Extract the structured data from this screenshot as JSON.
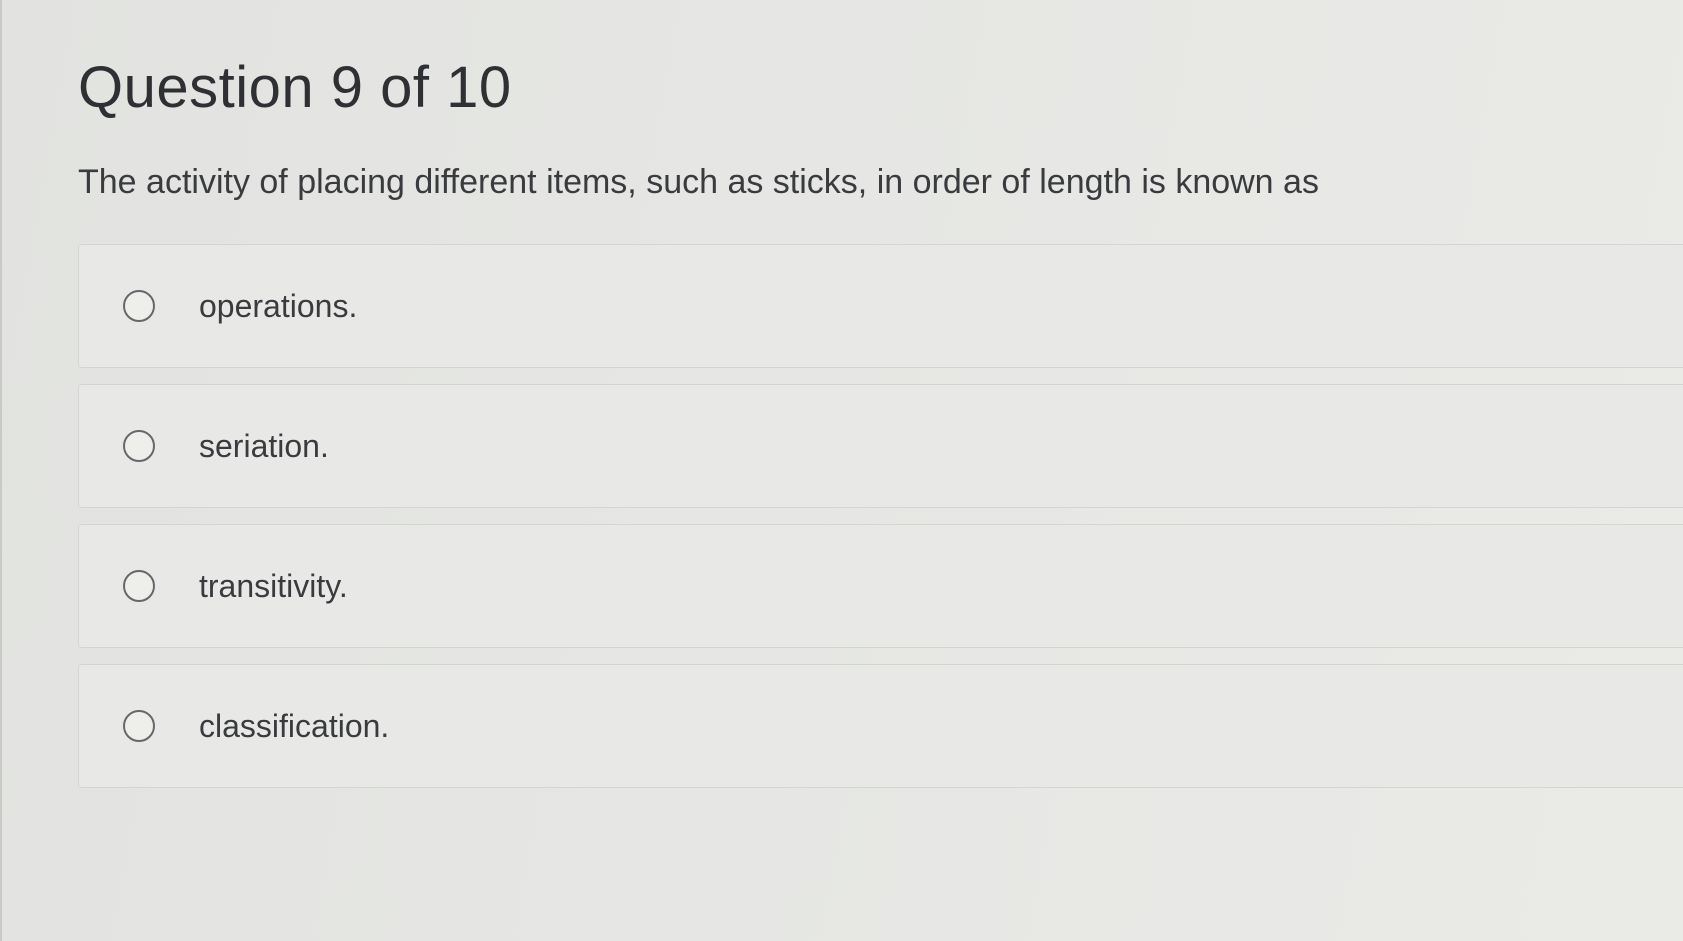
{
  "question": {
    "title": "Question 9 of 10",
    "text": "The activity of placing different items, such as sticks, in order of length is known as"
  },
  "options": [
    {
      "label": "operations.",
      "selected": false
    },
    {
      "label": "seriation.",
      "selected": false
    },
    {
      "label": "transitivity.",
      "selected": false
    },
    {
      "label": "classification.",
      "selected": false
    }
  ],
  "colors": {
    "background": "#e4e5e2",
    "text": "#3a3b3f",
    "radio_border": "#66676b",
    "option_border": "#d4d5d2"
  },
  "icons": {
    "radio": "radio-unchecked-icon"
  }
}
